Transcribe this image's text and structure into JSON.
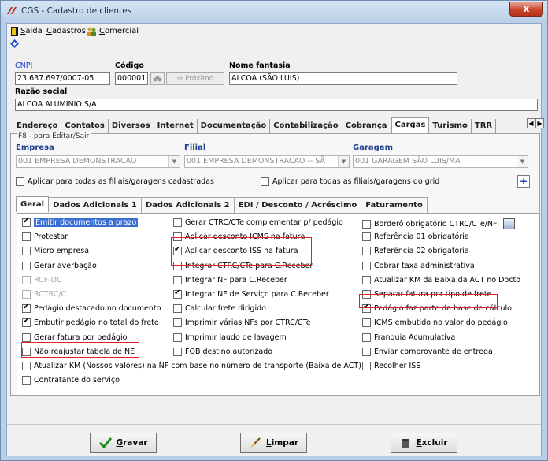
{
  "window": {
    "title": "CGS - Cadastro de clientes",
    "close_label": "x"
  },
  "menu": {
    "items": [
      {
        "name": "saida",
        "label": "Saida",
        "underline": "S",
        "rest": "aida"
      },
      {
        "name": "cadastros",
        "label": "Cadastros",
        "underline": "C",
        "rest": "adastros"
      },
      {
        "name": "comercial",
        "label": "Comercial",
        "underline": "C",
        "rest": "omercial"
      }
    ]
  },
  "header": {
    "cnpj_label": "CNPJ",
    "cnpj_value": "23.637.697/0007-05",
    "codigo_label": "Código",
    "codigo_value": "000001",
    "proximo_label": "Próximo",
    "nome_fantasia_label": "Nome fantasia",
    "nome_fantasia_value": "ALCOA (SÃO LUIS)",
    "razao_social_label": "Razão social",
    "razao_social_value": "ALCOA ALUMINIO S/A"
  },
  "main_tabs": [
    "Endereço",
    "Contatos",
    "Diversos",
    "Internet",
    "Documentação",
    "Contabilização",
    "Cobrança",
    "Cargas",
    "Turismo",
    "TRR"
  ],
  "active_main_tab": "Cargas",
  "cargas": {
    "hint": "F8 - para Editar/Sair",
    "empresa_label": "Empresa",
    "empresa_value": "001 EMPRESA DEMONSTRACAO",
    "filial_label": "Filial",
    "filial_value": "001 EMPRESA DEMONSTRACAO -- SÃ",
    "garagem_label": "Garagem",
    "garagem_value": "001 GARAGEM SÃO LUIS/MA",
    "aplicar_cadastradas": "Aplicar para todas as filiais/garagens cadastradas",
    "aplicar_grid": "Aplicar para todas as filiais/garagens do grid",
    "plus_label": "+"
  },
  "sub_tabs": [
    "Geral",
    "Dados Adicionais 1",
    "Dados Adicionais 2",
    "EDI / Desconto / Acréscimo",
    "Faturamento"
  ],
  "active_sub_tab": "Geral",
  "col1": [
    {
      "label": "Emitir documentos a prazo",
      "checked": true,
      "disabled": false,
      "selected": true
    },
    {
      "label": "Protestar",
      "checked": false,
      "disabled": false
    },
    {
      "label": "Micro empresa",
      "checked": false,
      "disabled": false
    },
    {
      "label": "Gerar averbação",
      "checked": false,
      "disabled": false
    },
    {
      "label": "RCF-DC",
      "checked": false,
      "disabled": true
    },
    {
      "label": "RCTRC/C",
      "checked": false,
      "disabled": true
    },
    {
      "label": "Pedágio destacado no documento",
      "checked": true,
      "disabled": false
    },
    {
      "label": "Embutir pedágio no total do frete",
      "checked": true,
      "disabled": false
    },
    {
      "label": "Gerar fatura por pedágio",
      "checked": false,
      "disabled": false
    },
    {
      "label": "Não reajustar tabela de NE",
      "checked": false,
      "disabled": false
    },
    {
      "label": "Atualizar KM (Nossos valores) na NF com base no número de transporte (Baixa de ACT)",
      "checked": false,
      "disabled": false
    },
    {
      "label": "Contratante do serviço",
      "checked": false,
      "disabled": false
    }
  ],
  "col2": [
    {
      "label": "Gerar CTRC/CTe complementar p/ pedágio",
      "checked": false
    },
    {
      "label": "Aplicar desconto ICMS na fatura",
      "checked": false
    },
    {
      "label": "Aplicar desconto ISS na fatura",
      "checked": true
    },
    {
      "label": "Integrar CTRC/CTe para C.Receber",
      "checked": false
    },
    {
      "label": "Integrar NF para C.Receber",
      "checked": false
    },
    {
      "label": "Integrar NF de Serviço para C.Receber",
      "checked": true
    },
    {
      "label": "Calcular frete dirigido",
      "checked": false
    },
    {
      "label": "Imprimir várias NFs por CTRC/CTe",
      "checked": false
    },
    {
      "label": "Imprimir laudo de lavagem",
      "checked": false
    },
    {
      "label": "FOB destino autorizado",
      "checked": false
    }
  ],
  "col3": [
    {
      "label": "Borderô obrigatório CTRC/CTe/NF",
      "checked": false
    },
    {
      "label": "Referência 01 obrigatória",
      "checked": false
    },
    {
      "label": "Referência 02 obrigatória",
      "checked": false
    },
    {
      "label": "Cobrar taxa administrativa",
      "checked": false
    },
    {
      "label": "Atualizar KM da Baixa da ACT no Docto",
      "checked": false
    },
    {
      "label": "Separar fatura por tipo de frete",
      "checked": false
    },
    {
      "label": "Pedágio faz parte da base de cálculo",
      "checked": true
    },
    {
      "label": "ICMS embutido no valor do pedágio",
      "checked": false
    },
    {
      "label": "Franquia Acumulativa",
      "checked": false
    },
    {
      "label": "Enviar comprovante de entrega",
      "checked": false
    },
    {
      "label": "Recolher ISS",
      "checked": false
    }
  ],
  "buttons": {
    "gravar": {
      "label": "Gravar",
      "underline": "G",
      "rest": "ravar"
    },
    "limpar": {
      "label": "Limpar",
      "underline": "L",
      "rest": "impar"
    },
    "excluir": {
      "label": "Excluir",
      "underline": "E",
      "rest": "xcluir"
    }
  },
  "colors": {
    "accent": "#1a39c9",
    "highlight": "#e0202a",
    "selection": "#3a6fd1"
  }
}
